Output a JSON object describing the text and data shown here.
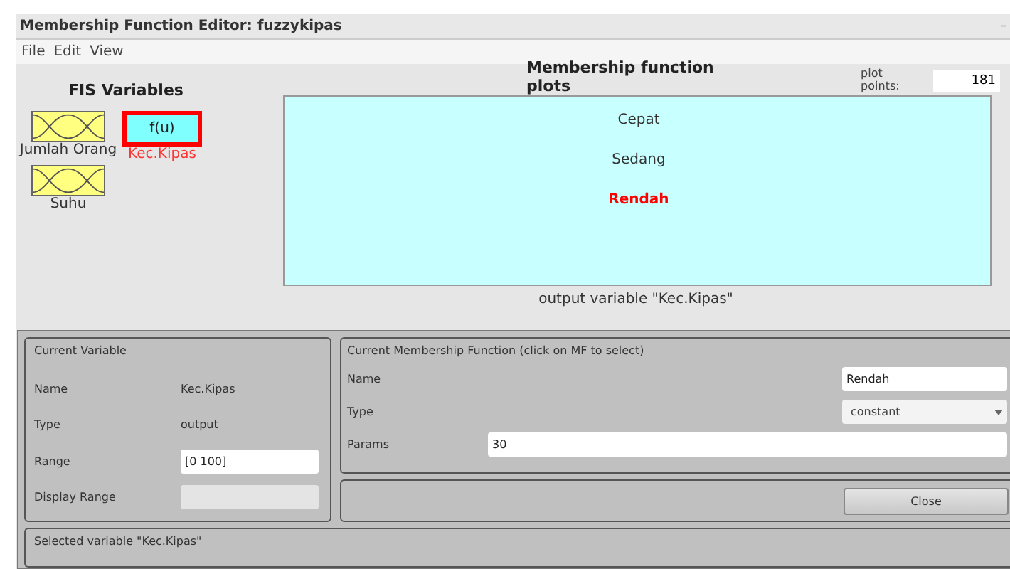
{
  "window": {
    "title": "Membership Function Editor: fuzzykipas",
    "controls": [
      "–"
    ]
  },
  "menu": [
    "File",
    "Edit",
    "View"
  ],
  "fis_variables": {
    "title": "FIS Variables",
    "variables": [
      {
        "name": "Jumlah Orang",
        "kind": "input",
        "selected": false
      },
      {
        "name": "Kec.Kipas",
        "kind": "output",
        "symbol": "f(u)",
        "selected": true
      },
      {
        "name": "Suhu",
        "kind": "input",
        "selected": false
      }
    ]
  },
  "plot": {
    "title": "Membership function plots",
    "plot_points_label": "plot points:",
    "plot_points": "181",
    "mfs": [
      {
        "name": "Cepat",
        "selected": false
      },
      {
        "name": "Sedang",
        "selected": false
      },
      {
        "name": "Rendah",
        "selected": true
      }
    ],
    "caption": "output variable \"Kec.Kipas\""
  },
  "current_variable": {
    "title": "Current Variable",
    "rows": [
      {
        "label": "Name",
        "kind": "text",
        "value": "Kec.Kipas"
      },
      {
        "label": "Type",
        "kind": "text",
        "value": "output"
      },
      {
        "label": "Range",
        "kind": "field",
        "value": "[0 100]"
      },
      {
        "label": "Display Range",
        "kind": "field",
        "disabled": true
      }
    ]
  },
  "current_mf": {
    "title": "Current Membership Function (click on MF to select)",
    "name_label": "Name",
    "name": "Rendah",
    "type_label": "Type",
    "type": "constant",
    "params_label": "Params",
    "params": "30"
  },
  "close_button": "Close",
  "status": "Selected variable \"Kec.Kipas\""
}
